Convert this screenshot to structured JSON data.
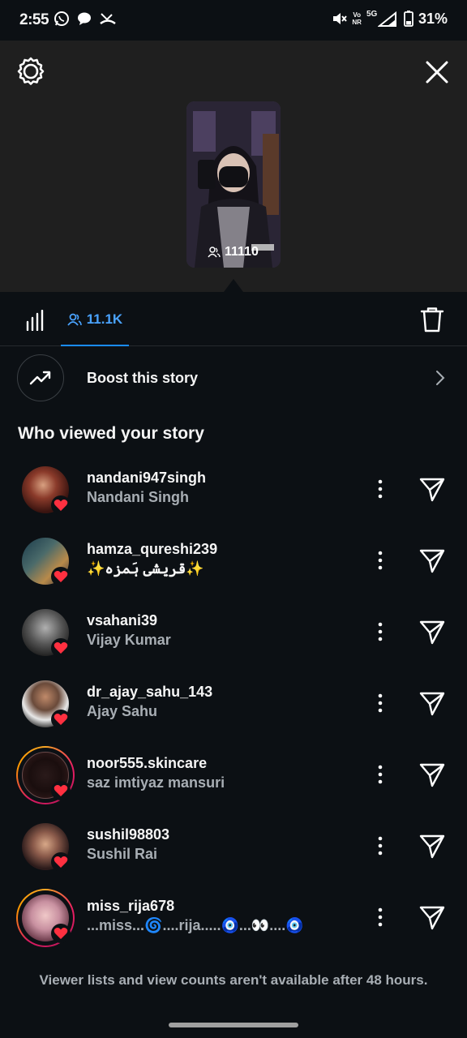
{
  "status_bar": {
    "time": "2:55",
    "battery": "31%",
    "net_top": "Vo",
    "net_bottom": "NR",
    "signal": "5G"
  },
  "story_preview": {
    "view_count": "11110"
  },
  "tabs": {
    "viewers_count": "11.1K"
  },
  "boost": {
    "label": "Boost this story"
  },
  "section_title": "Who viewed your story",
  "viewers": [
    {
      "username": "nandani947singh",
      "name": "Nandani Singh",
      "ring": false
    },
    {
      "username": "hamza_qureshi239",
      "name": "✨قریشی ہَمزہ✨",
      "ring": false
    },
    {
      "username": "vsahani39",
      "name": "Vijay Kumar",
      "ring": false
    },
    {
      "username": "dr_ajay_sahu_143",
      "name": "Ajay Sahu",
      "ring": false
    },
    {
      "username": "noor555.skincare",
      "name": "saz imtiyaz mansuri",
      "ring": true
    },
    {
      "username": "sushil98803",
      "name": "Sushil Rai",
      "ring": false
    },
    {
      "username": "miss_rija678",
      "name": "...miss...🌀....rija.....🧿...👀....🧿",
      "ring": true
    }
  ],
  "footer_note": "Viewer lists and view counts aren't available after 48 hours.",
  "colors": {
    "background": "#0c1014",
    "header_bg": "#1f1f1f",
    "accent": "#1a8cff",
    "heart": "#ff3040",
    "secondary_text": "#a8aeb4"
  },
  "icons": {
    "settings": "settings-gear-icon",
    "close": "close-icon",
    "insights": "bar-chart-icon",
    "viewers": "people-icon",
    "delete": "trash-icon",
    "boost": "trending-up-icon",
    "more": "more-vertical-icon",
    "send": "send-icon",
    "heart": "heart-icon"
  }
}
